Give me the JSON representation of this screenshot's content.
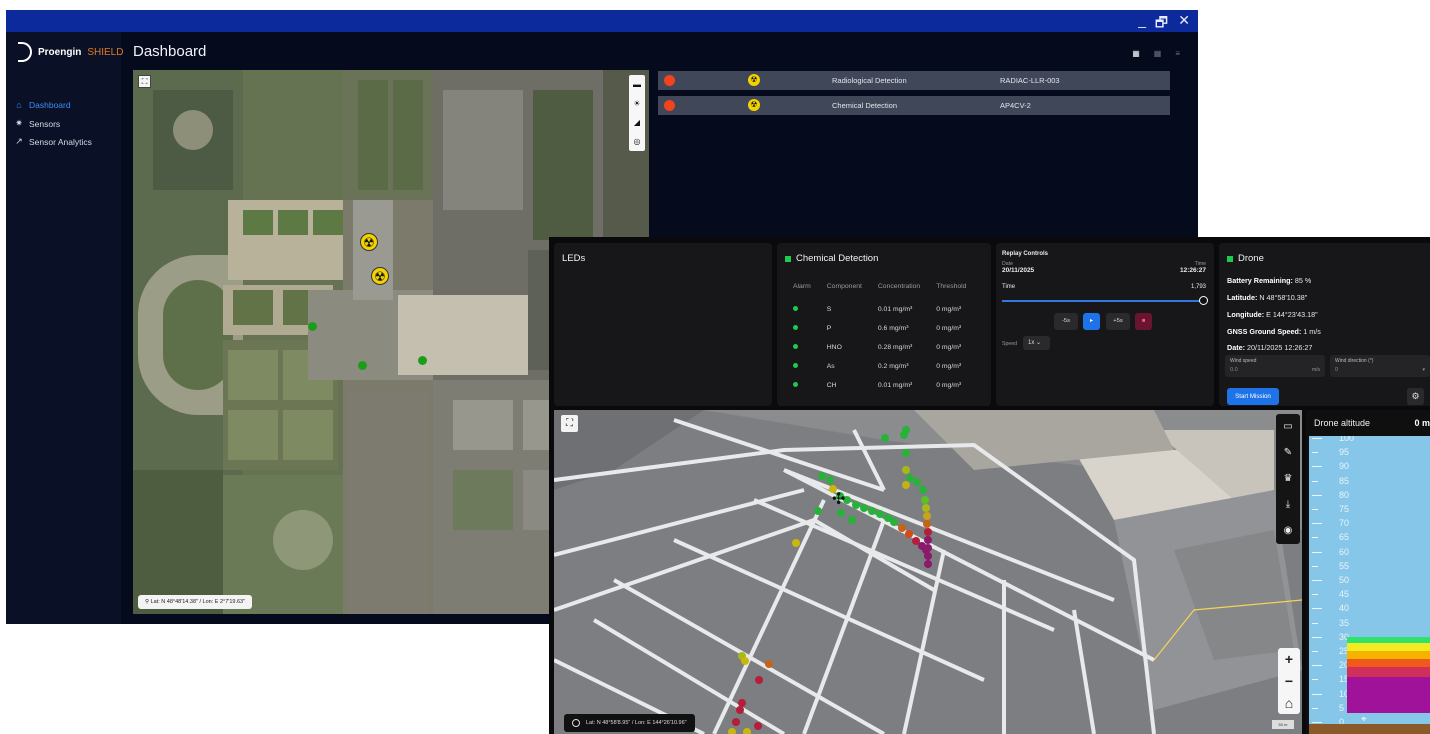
{
  "back_window": {
    "window_controls": [
      "_",
      "🗗",
      "✕"
    ],
    "brand": {
      "name": "Proengin",
      "product": "SHIELD"
    },
    "page_title": "Dashboard",
    "nav": [
      {
        "label": "Dashboard",
        "icon": "home-icon",
        "active": true
      },
      {
        "label": "Sensors",
        "icon": "sensor-icon",
        "active": false
      },
      {
        "label": "Sensor Analytics",
        "icon": "chart-line-icon",
        "active": false
      }
    ],
    "map": {
      "coordinates": "Lat: N 48°48'14.38\" / Lon: E 2°7'19.63\"",
      "tools": [
        "folder-icon",
        "sun-icon",
        "measure-icon",
        "locate-icon"
      ]
    },
    "detections": [
      {
        "name": "Radiological Detection",
        "id": "RADIAC-LLR-003",
        "status_color": "#f2431f"
      },
      {
        "name": "Chemical Detection",
        "id": "AP4CV-2",
        "status_color": "#f2431f"
      }
    ]
  },
  "front_window": {
    "leds": {
      "title": "LEDs"
    },
    "chemical": {
      "title": "Chemical Detection",
      "headers": [
        "Alarm",
        "Component",
        "Concentration",
        "Threshold"
      ],
      "rows": [
        {
          "component": "S",
          "concentration": "0.01 mg/m³",
          "threshold": "0 mg/m³"
        },
        {
          "component": "P",
          "concentration": "0.6 mg/m³",
          "threshold": "0 mg/m³"
        },
        {
          "component": "HNO",
          "concentration": "0.28 mg/m³",
          "threshold": "0 mg/m³"
        },
        {
          "component": "As",
          "concentration": "0.2 mg/m³",
          "threshold": "0 mg/m³"
        },
        {
          "component": "CH",
          "concentration": "0.01 mg/m³",
          "threshold": "0 mg/m³"
        }
      ]
    },
    "replay": {
      "title": "Replay Controls",
      "date_label": "Date",
      "date": "20/11/2025",
      "time_label": "Time",
      "time": "12:26:27",
      "slider_label": "Time",
      "slider_value": "1,793",
      "slider_fraction": 0.98,
      "buttons": [
        "-5s",
        "▸",
        "+5s",
        "■"
      ],
      "speed_label": "Speed",
      "speed_value": "1x"
    },
    "drone": {
      "title": "Drone",
      "battery_label": "Battery Remaining:",
      "battery": "85 %",
      "lat_label": "Latitude:",
      "lat": "N 48°58'10.38\"",
      "lon_label": "Longitude:",
      "lon": "E 144°23'43.18\"",
      "speed_label": "GNSS Ground Speed:",
      "speed": "1 m/s",
      "date_label": "Date:",
      "date": "20/11/2025 12:26:27",
      "wind_speed_label": "Wind speed",
      "wind_speed_value": "0.0",
      "wind_speed_unit": "m/s",
      "wind_dir_label": "Wind direction (°)",
      "wind_dir_value": "0",
      "start_label": "Start Mission"
    },
    "map3d": {
      "coordinates": "Lat: N 48°58'8.95\" / Lon: E 144°26'10.96\"",
      "tools": [
        "folder-icon",
        "pencil-icon",
        "crown-icon",
        "download-icon",
        "locate-icon"
      ],
      "zoom": [
        "+",
        "−",
        "⌂"
      ],
      "scale": "50 m"
    },
    "altitude": {
      "title": "Drone altitude",
      "value": "0 m",
      "ticks": [
        "100",
        "95",
        "90",
        "85",
        "80",
        "75",
        "70",
        "65",
        "60",
        "55",
        "50",
        "45",
        "40",
        "35",
        "30",
        "25",
        "20",
        "15",
        "10",
        "5",
        "0"
      ],
      "band_colors": [
        "#2fe36a",
        "#f2ea22",
        "#f5b300",
        "#ef5a1c",
        "#d02f5a",
        "#a0129a"
      ]
    }
  }
}
